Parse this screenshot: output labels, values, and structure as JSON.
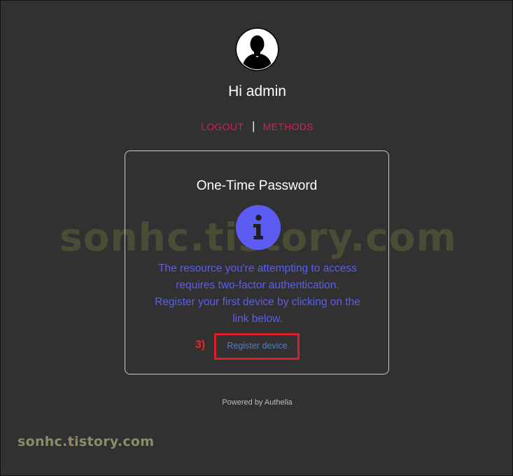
{
  "header": {
    "greeting": "Hi admin",
    "logout_label": "LOGOUT",
    "separator": "|",
    "methods_label": "METHODS"
  },
  "card": {
    "title": "One-Time Password",
    "message_lines": [
      "The resource you're attempting to access",
      "requires two-factor authentication.",
      "Register your first device by clicking on the",
      "link below."
    ],
    "register_label": "Register device"
  },
  "annotation": {
    "step_label": "3)"
  },
  "footer": {
    "powered_by": "Powered by Authelia"
  },
  "watermarks": {
    "large": "sonhc.tistory.com",
    "small": "sonhc.tistory.com"
  },
  "icons": {
    "avatar": "user-avatar-icon",
    "info": "info-icon"
  },
  "colors": {
    "background": "#313131",
    "accent_link": "#e3194f",
    "info_purple": "#5c5cf2",
    "register_blue": "#4a7fd0",
    "annotation_red": "#d8202a"
  }
}
